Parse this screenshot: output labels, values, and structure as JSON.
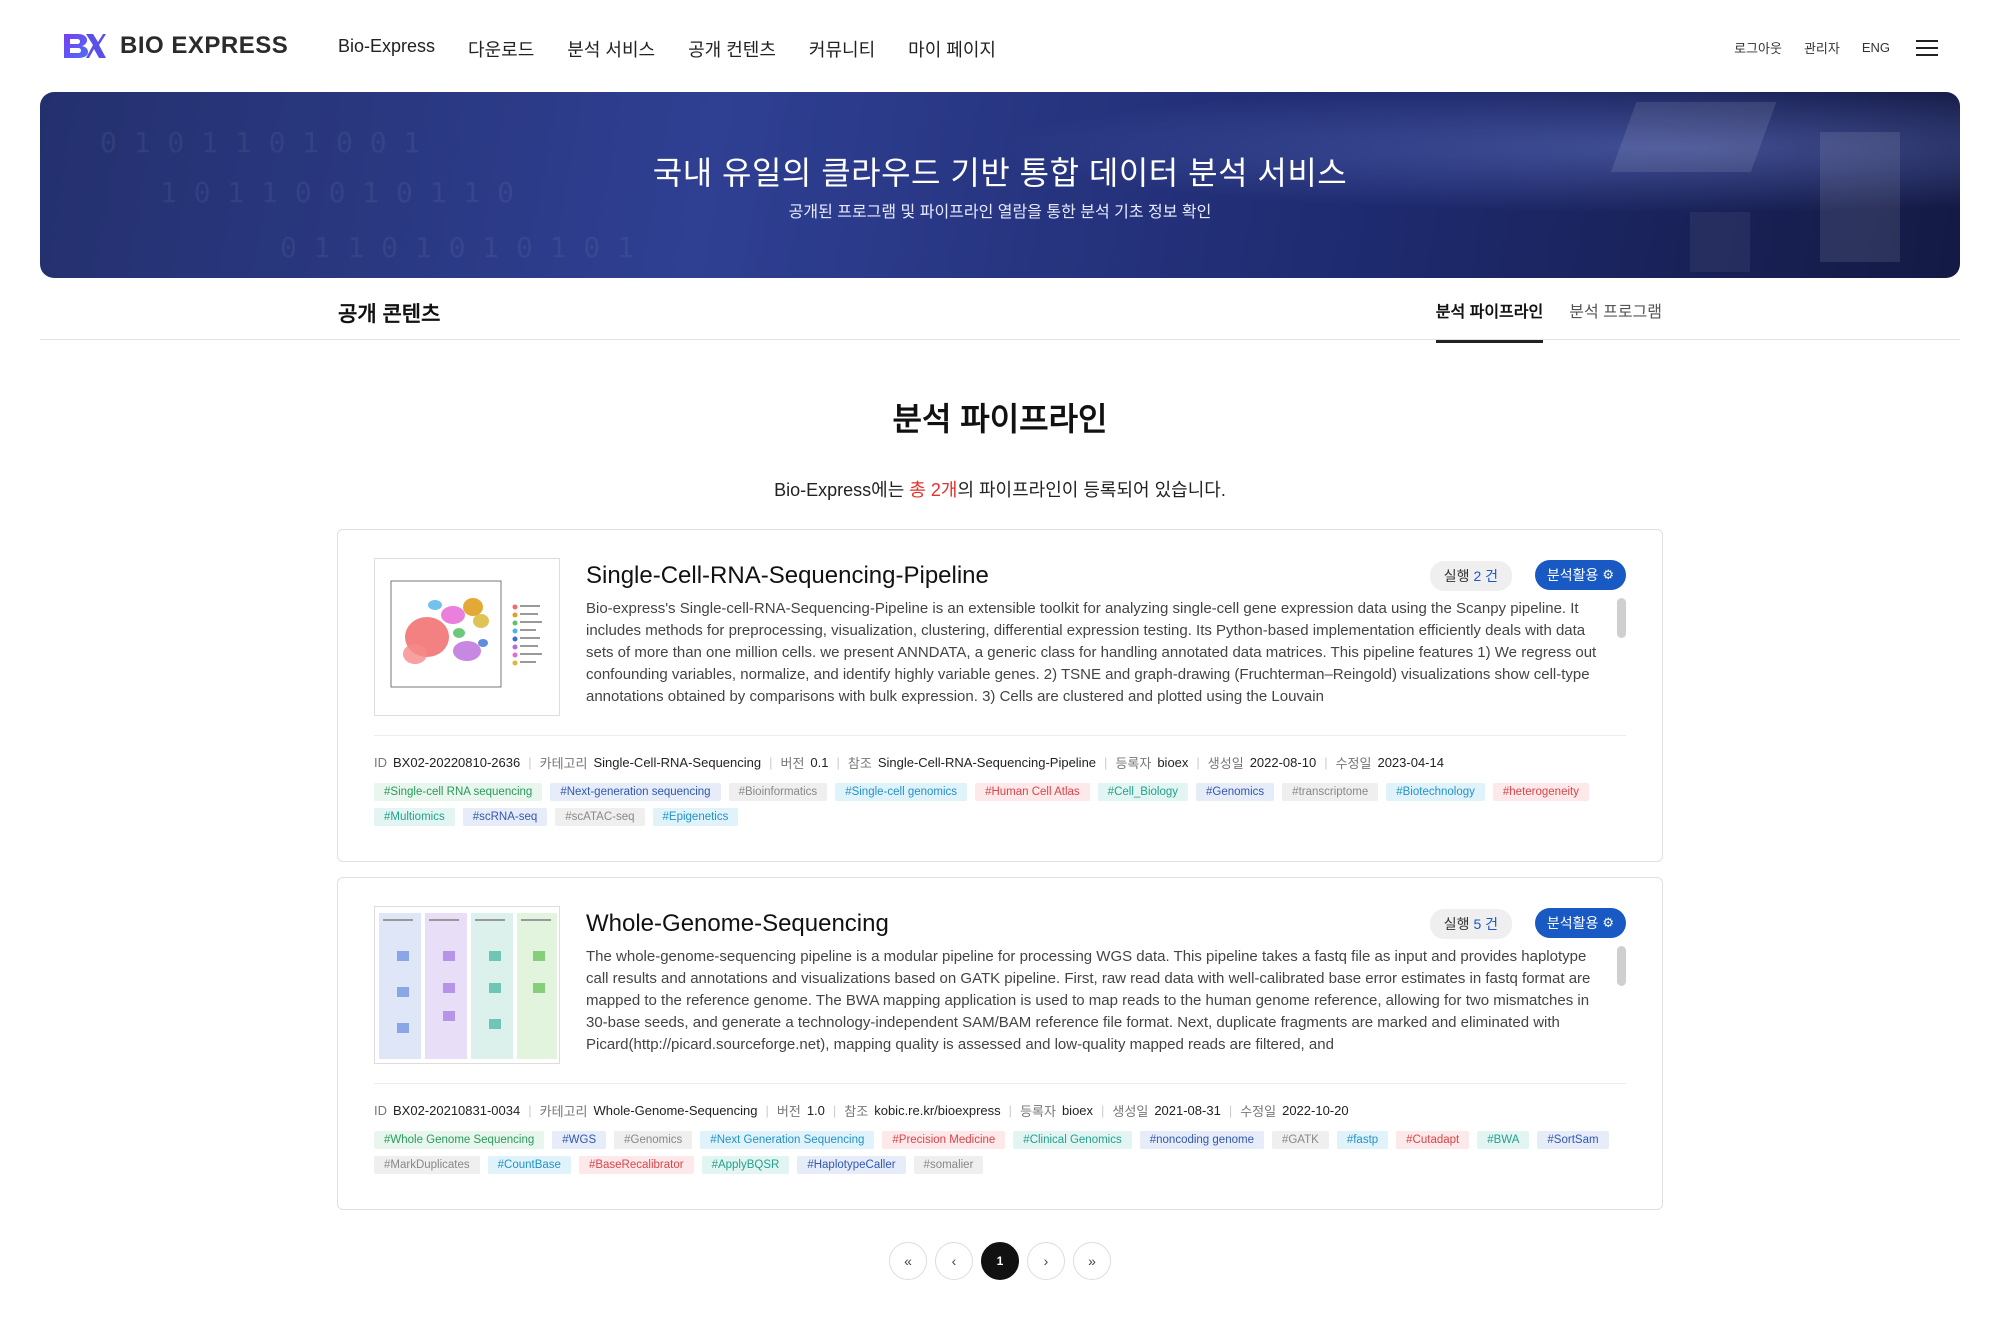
{
  "brand": {
    "name": "BIO EXPRESS",
    "logo_mark": "BX"
  },
  "nav": {
    "items": [
      {
        "label": "Bio-Express"
      },
      {
        "label": "다운로드"
      },
      {
        "label": "분석 서비스"
      },
      {
        "label": "공개 컨텐츠"
      },
      {
        "label": "커뮤니티"
      },
      {
        "label": "마이 페이지"
      }
    ],
    "util": {
      "logout": "로그아웃",
      "admin": "관리자",
      "lang": "ENG"
    },
    "menu_icon": "hamburger-icon"
  },
  "banner": {
    "title": "국내 유일의 클라우드 기반 통합 데이터 분석 서비스",
    "subtitle": "공개된 프로그램 및 파이프라인 열람을 통한 분석 기초 정보 확인"
  },
  "section": {
    "title": "공개 콘텐츠",
    "tabs": [
      {
        "label": "분석 파이프라인",
        "active": true
      },
      {
        "label": "분석 프로그램",
        "active": false
      }
    ]
  },
  "main": {
    "heading": "분석 파이프라인",
    "summary_prefix": "Bio-Express에는 ",
    "summary_highlight": "총 2개",
    "summary_suffix": "의 파이프라인이 등록되어 있습니다."
  },
  "pipelines": [
    {
      "title": "Single-Cell-RNA-Sequencing-Pipeline",
      "run_label": "실행",
      "run_count": "2 건",
      "use_label": "분석활용",
      "description": "Bio-express's Single-cell-RNA-Sequencing-Pipeline is an extensible toolkit for analyzing single-cell gene expression data using the Scanpy pipeline. It includes methods for preprocessing, visualization, clustering, differential expression testing. Its Python-based implementation efficiently deals with data sets of more than one million cells. we present ANNDATA, a generic class for handling annotated data matrices. This pipeline features 1) We regress out confounding variables, normalize, and identify highly variable genes. 2) TSNE and graph-drawing (Fruchterman–Reingold) visualizations show cell-type annotations obtained by comparisons with bulk expression. 3) Cells are clustered and plotted using the Louvain",
      "meta": {
        "id_label": "ID",
        "id": "BX02-20220810-2636",
        "category_label": "카테고리",
        "category": "Single-Cell-RNA-Sequencing",
        "version_label": "버전",
        "version": "0.1",
        "ref_label": "참조",
        "ref": "Single-Cell-RNA-Sequencing-Pipeline",
        "author_label": "등록자",
        "author": "bioex",
        "created_label": "생성일",
        "created": "2022-08-10",
        "modified_label": "수정일",
        "modified": "2023-04-14"
      },
      "tags": [
        {
          "text": "#Single-cell RNA sequencing",
          "color": "green"
        },
        {
          "text": "#Next-generation sequencing",
          "color": "blue"
        },
        {
          "text": "#Bioinformatics",
          "color": "gray"
        },
        {
          "text": "#Single-cell genomics",
          "color": "cyan"
        },
        {
          "text": "#Human Cell Atlas",
          "color": "red"
        },
        {
          "text": "#Cell_Biology",
          "color": "teal"
        },
        {
          "text": "#Genomics",
          "color": "blue"
        },
        {
          "text": "#transcriptome",
          "color": "gray"
        },
        {
          "text": "#Biotechnology",
          "color": "cyan"
        },
        {
          "text": "#heterogeneity",
          "color": "red"
        },
        {
          "text": "#Multiomics",
          "color": "teal"
        },
        {
          "text": "#scRNA-seq",
          "color": "blue"
        },
        {
          "text": "#scATAC-seq",
          "color": "gray"
        },
        {
          "text": "#Epigenetics",
          "color": "cyan"
        }
      ]
    },
    {
      "title": "Whole-Genome-Sequencing",
      "run_label": "실행",
      "run_count": "5 건",
      "use_label": "분석활용",
      "description": "The whole-genome-sequencing pipeline is a modular pipeline for processing WGS data. This pipeline takes a fastq file as input and provides haplotype call results and annotations and visualizations based on GATK pipeline. First, raw read data with well-calibrated base error estimates in fastq format are mapped to the reference genome. The BWA mapping application is used to map reads to the human genome reference, allowing for two mismatches in 30-base seeds, and generate a technology-independent SAM/BAM reference file format. Next, duplicate fragments are marked and eliminated with Picard(http://picard.sourceforge.net), mapping quality is assessed and low-quality mapped reads are filtered, and",
      "meta": {
        "id_label": "ID",
        "id": "BX02-20210831-0034",
        "category_label": "카테고리",
        "category": "Whole-Genome-Sequencing",
        "version_label": "버전",
        "version": "1.0",
        "ref_label": "참조",
        "ref": "kobic.re.kr/bioexpress",
        "author_label": "등록자",
        "author": "bioex",
        "created_label": "생성일",
        "created": "2021-08-31",
        "modified_label": "수정일",
        "modified": "2022-10-20"
      },
      "tags": [
        {
          "text": "#Whole Genome Sequencing",
          "color": "green"
        },
        {
          "text": "#WGS",
          "color": "blue"
        },
        {
          "text": "#Genomics",
          "color": "gray"
        },
        {
          "text": "#Next Generation Sequencing",
          "color": "cyan"
        },
        {
          "text": "#Precision Medicine",
          "color": "red"
        },
        {
          "text": "#Clinical Genomics",
          "color": "teal"
        },
        {
          "text": "#noncoding genome",
          "color": "blue"
        },
        {
          "text": "#GATK",
          "color": "gray"
        },
        {
          "text": "#fastp",
          "color": "cyan"
        },
        {
          "text": "#Cutadapt",
          "color": "red"
        },
        {
          "text": "#BWA",
          "color": "teal"
        },
        {
          "text": "#SortSam",
          "color": "blue"
        },
        {
          "text": "#MarkDuplicates",
          "color": "gray"
        },
        {
          "text": "#CountBase",
          "color": "cyan"
        },
        {
          "text": "#BaseRecalibrator",
          "color": "red"
        },
        {
          "text": "#ApplyBQSR",
          "color": "teal"
        },
        {
          "text": "#HaplotypeCaller",
          "color": "blue"
        },
        {
          "text": "#somalier",
          "color": "gray"
        }
      ]
    }
  ],
  "pagination": {
    "first_icon": "double-chevron-left-icon",
    "prev_icon": "chevron-left-icon",
    "current": "1",
    "next_icon": "chevron-right-icon",
    "last_icon": "double-chevron-right-icon"
  },
  "colors": {
    "accent_blue": "#1859c4",
    "highlight_red": "#e0322b",
    "banner_dark": "#1e2a6e"
  }
}
